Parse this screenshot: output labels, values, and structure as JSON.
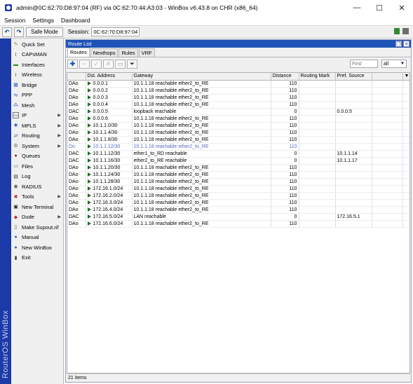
{
  "window": {
    "title": "admin@0C:62:70:D8:97:04 (RF) via 0C:62:70:44:A3:03 - WinBox v6.43.8 on CHR (x86_64)",
    "controls": [
      "—",
      "☐",
      "✕"
    ]
  },
  "menu": [
    "Session",
    "Settings",
    "Dashboard"
  ],
  "toolbar": {
    "undo": "↶",
    "redo": "↷",
    "safe_mode_label": "Safe Mode",
    "session_label": "Session:",
    "session_value": "0C:62:70:D8:97:04"
  },
  "brand_text": "RouterOS WinBox",
  "sidebar": [
    {
      "label": "Quick Set",
      "icon": "quick-set-icon",
      "glyph": "✎",
      "color": "#b07a1a",
      "arrow": false
    },
    {
      "label": "CAPsMAN",
      "icon": "capsman-icon",
      "glyph": "Ⅰ",
      "color": "#555555",
      "arrow": false
    },
    {
      "label": "Interfaces",
      "icon": "interfaces-icon",
      "glyph": "▬",
      "color": "#2a8a2a",
      "arrow": false
    },
    {
      "label": "Wireless",
      "icon": "wireless-icon",
      "glyph": "Ⅰ",
      "color": "#555555",
      "arrow": false
    },
    {
      "label": "Bridge",
      "icon": "bridge-icon",
      "glyph": "▦",
      "color": "#2a62c8",
      "arrow": false
    },
    {
      "label": "PPP",
      "icon": "ppp-icon",
      "glyph": "⇆",
      "color": "#2a62c8",
      "arrow": false
    },
    {
      "label": "Mesh",
      "icon": "mesh-icon",
      "glyph": "⁂",
      "color": "#2a62c8",
      "arrow": false
    },
    {
      "label": "IP",
      "icon": "ip-icon",
      "glyph": "255",
      "color": "#666666",
      "arrow": true
    },
    {
      "label": "MPLS",
      "icon": "mpls-icon",
      "glyph": "✱",
      "color": "#2a62c8",
      "arrow": true
    },
    {
      "label": "Routing",
      "icon": "routing-icon",
      "glyph": "⇄",
      "color": "#2a62c8",
      "arrow": true
    },
    {
      "label": "System",
      "icon": "system-icon",
      "glyph": "⚙",
      "color": "#666666",
      "arrow": true
    },
    {
      "label": "Queues",
      "icon": "queues-icon",
      "glyph": "●",
      "color": "#a01818",
      "arrow": false
    },
    {
      "label": "Files",
      "icon": "files-icon",
      "glyph": "▭",
      "color": "#3a6ab8",
      "arrow": false
    },
    {
      "label": "Log",
      "icon": "log-icon",
      "glyph": "▤",
      "color": "#333333",
      "arrow": false
    },
    {
      "label": "RADIUS",
      "icon": "radius-icon",
      "glyph": "◉",
      "color": "#555555",
      "arrow": false
    },
    {
      "label": "Tools",
      "icon": "tools-icon",
      "glyph": "✖",
      "color": "#b02020",
      "arrow": true
    },
    {
      "label": "New Terminal",
      "icon": "terminal-icon",
      "glyph": "▣",
      "color": "#222222",
      "arrow": false
    },
    {
      "label": "Dude",
      "icon": "dude-icon",
      "glyph": "◆",
      "color": "#c03030",
      "arrow": true
    },
    {
      "label": "Make Supout.rif",
      "icon": "supout-icon",
      "glyph": "▯",
      "color": "#555555",
      "arrow": false
    },
    {
      "label": "Manual",
      "icon": "manual-icon",
      "glyph": "●",
      "color": "#2a62c8",
      "arrow": false
    },
    {
      "label": "New WinBox",
      "icon": "winbox-icon",
      "glyph": "●",
      "color": "#2a62c8",
      "arrow": false
    },
    {
      "label": "Exit",
      "icon": "exit-icon",
      "glyph": "▮",
      "color": "#444444",
      "arrow": false
    }
  ],
  "route_list": {
    "title": "Route List",
    "tabs": [
      "Routes",
      "Nexthops",
      "Rules",
      "VRF"
    ],
    "find_placeholder": "Find",
    "filter_value": "all",
    "columns": [
      "",
      "Dst. Address",
      "Gateway",
      "Distance",
      "Routing Mark",
      "Pref. Source"
    ],
    "rows": [
      {
        "flags": "DAo",
        "dst": "0.0.0.1",
        "gateway": "10.1.1.18 reachable ether2_to_RE",
        "distance": "110",
        "mark": "",
        "pref": "",
        "disabled": false
      },
      {
        "flags": "DAo",
        "dst": "0.0.0.2",
        "gateway": "10.1.1.18 reachable ether2_to_RE",
        "distance": "110",
        "mark": "",
        "pref": "",
        "disabled": false
      },
      {
        "flags": "DAo",
        "dst": "0.0.0.3",
        "gateway": "10.1.1.18 reachable ether2_to_RE",
        "distance": "110",
        "mark": "",
        "pref": "",
        "disabled": false
      },
      {
        "flags": "DAo",
        "dst": "0.0.0.4",
        "gateway": "10.1.1.18 reachable ether2_to_RE",
        "distance": "110",
        "mark": "",
        "pref": "",
        "disabled": false
      },
      {
        "flags": "DAC",
        "dst": "0.0.0.5",
        "gateway": "loopback reachable",
        "distance": "0",
        "mark": "",
        "pref": "0.0.0.5",
        "disabled": false
      },
      {
        "flags": "DAo",
        "dst": "0.0.0.6",
        "gateway": "10.1.1.18 reachable ether2_to_RE",
        "distance": "110",
        "mark": "",
        "pref": "",
        "disabled": false
      },
      {
        "flags": "DAo",
        "dst": "10.1.1.0/30",
        "gateway": "10.1.1.18 reachable ether2_to_RE",
        "distance": "110",
        "mark": "",
        "pref": "",
        "disabled": false
      },
      {
        "flags": "DAo",
        "dst": "10.1.1.4/30",
        "gateway": "10.1.1.18 reachable ether2_to_RE",
        "distance": "110",
        "mark": "",
        "pref": "",
        "disabled": false
      },
      {
        "flags": "DAo",
        "dst": "10.1.1.8/30",
        "gateway": "10.1.1.18 reachable ether2_to_RE",
        "distance": "110",
        "mark": "",
        "pref": "",
        "disabled": false
      },
      {
        "flags": "Do",
        "dst": "10.1.1.12/30",
        "gateway": "10.1.1.18 reachable ether2_to_RE",
        "distance": "110",
        "mark": "",
        "pref": "",
        "disabled": true
      },
      {
        "flags": "DAC",
        "dst": "10.1.1.12/30",
        "gateway": "ether1_to_RD reachable",
        "distance": "0",
        "mark": "",
        "pref": "10.1.1.14",
        "disabled": false
      },
      {
        "flags": "DAC",
        "dst": "10.1.1.16/30",
        "gateway": "ether2_to_RE reachable",
        "distance": "0",
        "mark": "",
        "pref": "10.1.1.17",
        "disabled": false
      },
      {
        "flags": "DAo",
        "dst": "10.1.1.20/30",
        "gateway": "10.1.1.18 reachable ether2_to_RE",
        "distance": "110",
        "mark": "",
        "pref": "",
        "disabled": false
      },
      {
        "flags": "DAo",
        "dst": "10.1.1.24/30",
        "gateway": "10.1.1.18 reachable ether2_to_RE",
        "distance": "110",
        "mark": "",
        "pref": "",
        "disabled": false
      },
      {
        "flags": "DAo",
        "dst": "10.1.1.28/30",
        "gateway": "10.1.1.18 reachable ether2_to_RE",
        "distance": "110",
        "mark": "",
        "pref": "",
        "disabled": false
      },
      {
        "flags": "DAo",
        "dst": "172.16.1.0/24",
        "gateway": "10.1.1.18 reachable ether2_to_RE",
        "distance": "110",
        "mark": "",
        "pref": "",
        "disabled": false
      },
      {
        "flags": "DAo",
        "dst": "172.16.2.0/24",
        "gateway": "10.1.1.18 reachable ether2_to_RE",
        "distance": "110",
        "mark": "",
        "pref": "",
        "disabled": false
      },
      {
        "flags": "DAo",
        "dst": "172.16.3.0/24",
        "gateway": "10.1.1.18 reachable ether2_to_RE",
        "distance": "110",
        "mark": "",
        "pref": "",
        "disabled": false
      },
      {
        "flags": "DAo",
        "dst": "172.16.4.0/24",
        "gateway": "10.1.1.18 reachable ether2_to_RE",
        "distance": "110",
        "mark": "",
        "pref": "",
        "disabled": false
      },
      {
        "flags": "DAC",
        "dst": "172.16.5.0/24",
        "gateway": "LAN reachable",
        "distance": "0",
        "mark": "",
        "pref": "172.16.5.1",
        "disabled": false
      },
      {
        "flags": "DAo",
        "dst": "172.16.6.0/24",
        "gateway": "10.1.1.18 reachable ether2_to_RE",
        "distance": "110",
        "mark": "",
        "pref": "",
        "disabled": false
      }
    ],
    "status": "21 items"
  }
}
